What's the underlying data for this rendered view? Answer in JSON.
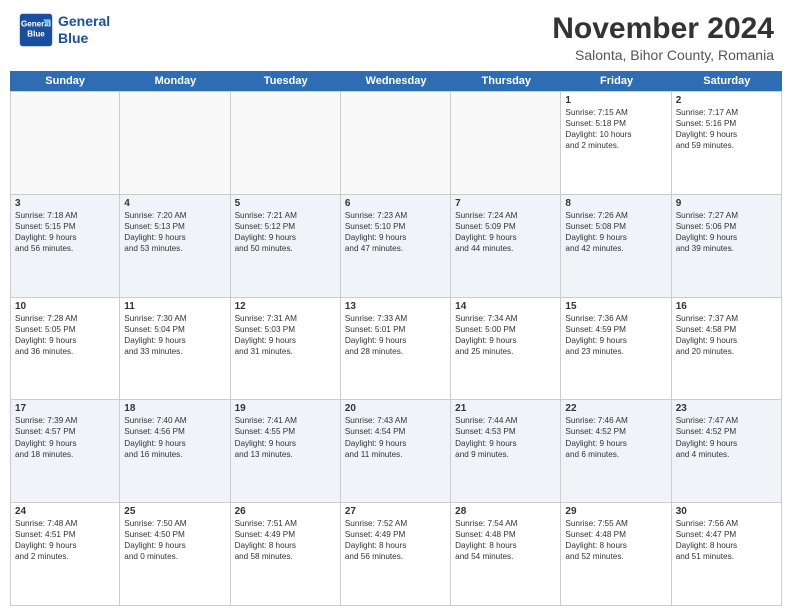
{
  "logo": {
    "line1": "General",
    "line2": "Blue"
  },
  "title": "November 2024",
  "subtitle": "Salonta, Bihor County, Romania",
  "days": [
    "Sunday",
    "Monday",
    "Tuesday",
    "Wednesday",
    "Thursday",
    "Friday",
    "Saturday"
  ],
  "weeks": [
    [
      {
        "day": "",
        "info": ""
      },
      {
        "day": "",
        "info": ""
      },
      {
        "day": "",
        "info": ""
      },
      {
        "day": "",
        "info": ""
      },
      {
        "day": "",
        "info": ""
      },
      {
        "day": "1",
        "info": "Sunrise: 7:15 AM\nSunset: 5:18 PM\nDaylight: 10 hours\nand 2 minutes."
      },
      {
        "day": "2",
        "info": "Sunrise: 7:17 AM\nSunset: 5:16 PM\nDaylight: 9 hours\nand 59 minutes."
      }
    ],
    [
      {
        "day": "3",
        "info": "Sunrise: 7:18 AM\nSunset: 5:15 PM\nDaylight: 9 hours\nand 56 minutes."
      },
      {
        "day": "4",
        "info": "Sunrise: 7:20 AM\nSunset: 5:13 PM\nDaylight: 9 hours\nand 53 minutes."
      },
      {
        "day": "5",
        "info": "Sunrise: 7:21 AM\nSunset: 5:12 PM\nDaylight: 9 hours\nand 50 minutes."
      },
      {
        "day": "6",
        "info": "Sunrise: 7:23 AM\nSunset: 5:10 PM\nDaylight: 9 hours\nand 47 minutes."
      },
      {
        "day": "7",
        "info": "Sunrise: 7:24 AM\nSunset: 5:09 PM\nDaylight: 9 hours\nand 44 minutes."
      },
      {
        "day": "8",
        "info": "Sunrise: 7:26 AM\nSunset: 5:08 PM\nDaylight: 9 hours\nand 42 minutes."
      },
      {
        "day": "9",
        "info": "Sunrise: 7:27 AM\nSunset: 5:06 PM\nDaylight: 9 hours\nand 39 minutes."
      }
    ],
    [
      {
        "day": "10",
        "info": "Sunrise: 7:28 AM\nSunset: 5:05 PM\nDaylight: 9 hours\nand 36 minutes."
      },
      {
        "day": "11",
        "info": "Sunrise: 7:30 AM\nSunset: 5:04 PM\nDaylight: 9 hours\nand 33 minutes."
      },
      {
        "day": "12",
        "info": "Sunrise: 7:31 AM\nSunset: 5:03 PM\nDaylight: 9 hours\nand 31 minutes."
      },
      {
        "day": "13",
        "info": "Sunrise: 7:33 AM\nSunset: 5:01 PM\nDaylight: 9 hours\nand 28 minutes."
      },
      {
        "day": "14",
        "info": "Sunrise: 7:34 AM\nSunset: 5:00 PM\nDaylight: 9 hours\nand 25 minutes."
      },
      {
        "day": "15",
        "info": "Sunrise: 7:36 AM\nSunset: 4:59 PM\nDaylight: 9 hours\nand 23 minutes."
      },
      {
        "day": "16",
        "info": "Sunrise: 7:37 AM\nSunset: 4:58 PM\nDaylight: 9 hours\nand 20 minutes."
      }
    ],
    [
      {
        "day": "17",
        "info": "Sunrise: 7:39 AM\nSunset: 4:57 PM\nDaylight: 9 hours\nand 18 minutes."
      },
      {
        "day": "18",
        "info": "Sunrise: 7:40 AM\nSunset: 4:56 PM\nDaylight: 9 hours\nand 16 minutes."
      },
      {
        "day": "19",
        "info": "Sunrise: 7:41 AM\nSunset: 4:55 PM\nDaylight: 9 hours\nand 13 minutes."
      },
      {
        "day": "20",
        "info": "Sunrise: 7:43 AM\nSunset: 4:54 PM\nDaylight: 9 hours\nand 11 minutes."
      },
      {
        "day": "21",
        "info": "Sunrise: 7:44 AM\nSunset: 4:53 PM\nDaylight: 9 hours\nand 9 minutes."
      },
      {
        "day": "22",
        "info": "Sunrise: 7:46 AM\nSunset: 4:52 PM\nDaylight: 9 hours\nand 6 minutes."
      },
      {
        "day": "23",
        "info": "Sunrise: 7:47 AM\nSunset: 4:52 PM\nDaylight: 9 hours\nand 4 minutes."
      }
    ],
    [
      {
        "day": "24",
        "info": "Sunrise: 7:48 AM\nSunset: 4:51 PM\nDaylight: 9 hours\nand 2 minutes."
      },
      {
        "day": "25",
        "info": "Sunrise: 7:50 AM\nSunset: 4:50 PM\nDaylight: 9 hours\nand 0 minutes."
      },
      {
        "day": "26",
        "info": "Sunrise: 7:51 AM\nSunset: 4:49 PM\nDaylight: 8 hours\nand 58 minutes."
      },
      {
        "day": "27",
        "info": "Sunrise: 7:52 AM\nSunset: 4:49 PM\nDaylight: 8 hours\nand 56 minutes."
      },
      {
        "day": "28",
        "info": "Sunrise: 7:54 AM\nSunset: 4:48 PM\nDaylight: 8 hours\nand 54 minutes."
      },
      {
        "day": "29",
        "info": "Sunrise: 7:55 AM\nSunset: 4:48 PM\nDaylight: 8 hours\nand 52 minutes."
      },
      {
        "day": "30",
        "info": "Sunrise: 7:56 AM\nSunset: 4:47 PM\nDaylight: 8 hours\nand 51 minutes."
      }
    ]
  ]
}
